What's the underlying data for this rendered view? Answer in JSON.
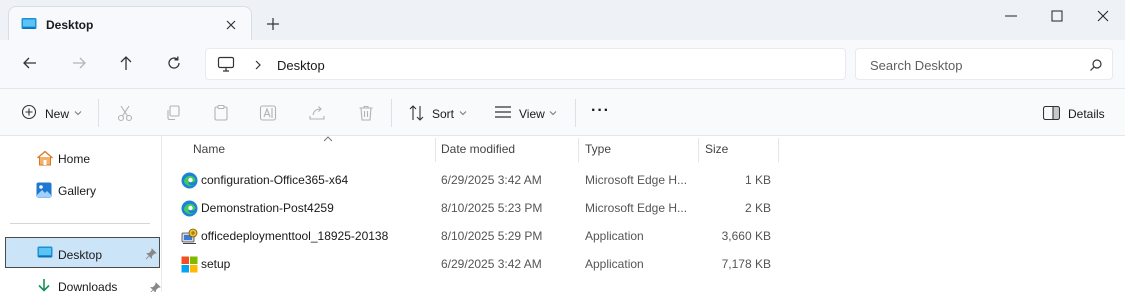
{
  "tab": {
    "title": "Desktop"
  },
  "address": {
    "crumb": "Desktop"
  },
  "search": {
    "placeholder": "Search Desktop"
  },
  "commands": {
    "new_label": "New",
    "sort_label": "Sort",
    "view_label": "View",
    "more_label": "···",
    "details_label": "Details"
  },
  "sidebar": {
    "items": [
      {
        "label": "Home"
      },
      {
        "label": "Gallery"
      },
      {
        "label": "Desktop"
      },
      {
        "label": "Downloads"
      }
    ]
  },
  "columns": [
    "Name",
    "Date modified",
    "Type",
    "Size"
  ],
  "files": [
    {
      "name": "configuration-Office365-x64",
      "date": "6/29/2025 3:42 AM",
      "type": "Microsoft Edge H...",
      "size": "1 KB",
      "icon": "edge-html-icon"
    },
    {
      "name": "Demonstration-Post4259",
      "date": "8/10/2025 5:23 PM",
      "type": "Microsoft Edge H...",
      "size": "2 KB",
      "icon": "edge-html-icon"
    },
    {
      "name": "officedeploymenttool_18925-20138",
      "date": "8/10/2025 5:29 PM",
      "type": "Application",
      "size": "3,660 KB",
      "icon": "installer-app-icon"
    },
    {
      "name": "setup",
      "date": "6/29/2025 3:42 AM",
      "type": "Application",
      "size": "7,178 KB",
      "icon": "windows-app-icon"
    }
  ],
  "colors": {
    "accent": "#0078d4",
    "selected_bg": "#cce4f7"
  }
}
